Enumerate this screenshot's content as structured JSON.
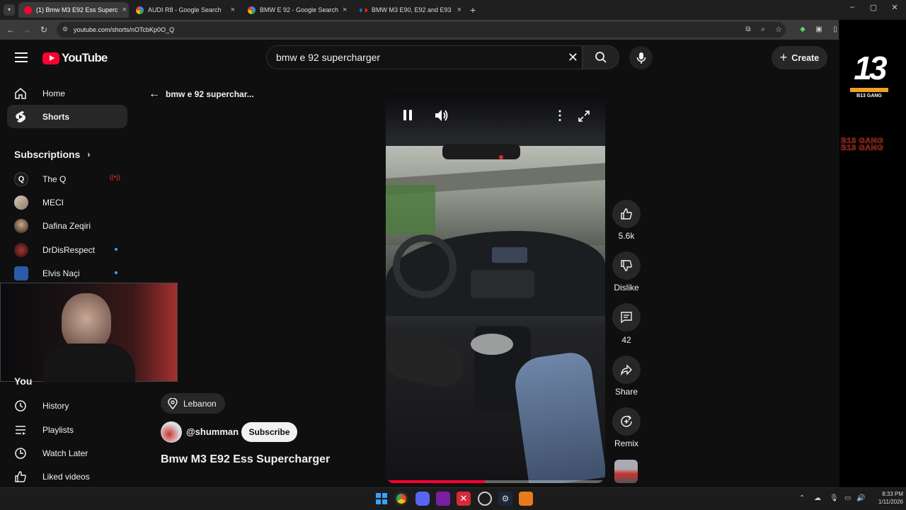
{
  "browser": {
    "tabs": [
      {
        "title": "(1) Bmw M3 E92 Ess Superc",
        "active": true
      },
      {
        "title": "AUDI R8 - Google Search",
        "active": false
      },
      {
        "title": "BMW E 92 - Google Search",
        "active": false
      },
      {
        "title": "BMW M3 E90, E92 and E93",
        "active": false
      }
    ],
    "url": "youtube.com/shorts/nOTcbKp0O_Q"
  },
  "header": {
    "logo_text": "YouTube",
    "search_value": "bmw e 92 supercharger",
    "create_label": "Create"
  },
  "sidebar": {
    "items": [
      {
        "label": "Home",
        "icon": "home-icon"
      },
      {
        "label": "Shorts",
        "icon": "shorts-icon"
      }
    ],
    "subscriptions_title": "Subscriptions",
    "subscriptions": [
      {
        "name": "The Q"
      },
      {
        "name": "MECI"
      },
      {
        "name": "Dafina Zeqiri"
      },
      {
        "name": "DrDisRespect"
      },
      {
        "name": "Elvis Naçi"
      }
    ],
    "you_label": "You",
    "you_items": [
      {
        "label": "History",
        "icon": "history-icon"
      },
      {
        "label": "Playlists",
        "icon": "playlists-icon"
      },
      {
        "label": "Watch Later",
        "icon": "watch-later-icon"
      },
      {
        "label": "Liked videos",
        "icon": "liked-icon"
      }
    ]
  },
  "shorts": {
    "back_label": "bmw e 92 superchar...",
    "location": "Lebanon",
    "channel": "@shumman",
    "subscribe_label": "Subscribe",
    "video_title": "Bmw M3 E92 Ess Supercharger",
    "likes": "5.6k",
    "dislike_label": "Dislike",
    "comments": "42",
    "share_label": "Share",
    "remix_label": "Remix",
    "progress": 0.45
  },
  "overlay": {
    "logo_text": "13",
    "logo_caption": "B13 GANG",
    "watermark_text": "B13 GANG"
  },
  "taskbar": {
    "time": "8:33 PM",
    "date": "1/11/2026"
  }
}
